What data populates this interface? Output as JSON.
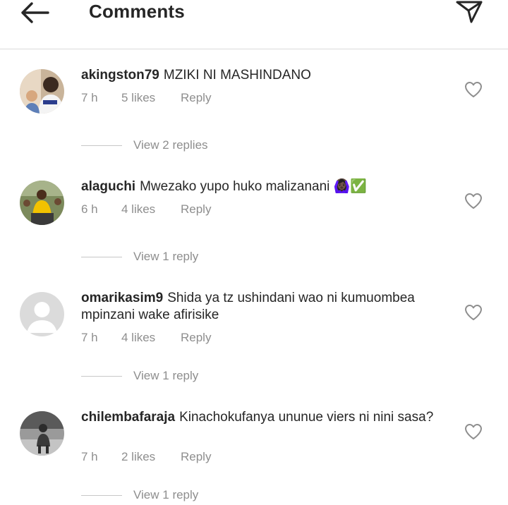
{
  "header": {
    "title": "Comments",
    "back_icon": "arrow-left-icon",
    "share_icon": "paper-plane-icon"
  },
  "comments": [
    {
      "username": "akingston79",
      "text": "MZIKI NI MASHINDANO",
      "time": "7 h",
      "likes": "5 likes",
      "reply": "Reply",
      "view_replies": "View 2 replies",
      "avatar_icon": "user-photo-avatar"
    },
    {
      "username": "alaguchi",
      "text": "Mwezako yupo huko malizanani 🙆🏿‍♀️✅",
      "time": "6 h",
      "likes": "4 likes",
      "reply": "Reply",
      "view_replies": "View 1 reply",
      "avatar_icon": "user-photo-avatar"
    },
    {
      "username": "omarikasim9",
      "text": "Shida ya tz ushindani wao ni kumuombea mpinzani wake afirisike",
      "time": "7 h",
      "likes": "4 likes",
      "reply": "Reply",
      "view_replies": "View 1 reply",
      "avatar_icon": "default-user-avatar"
    },
    {
      "username": "chilembafaraja",
      "text": "Kinachokufanya ununue viers  ni nini sasa?",
      "time": "7 h",
      "likes": "2 likes",
      "reply": "Reply",
      "view_replies": "View 1 reply",
      "avatar_icon": "user-photo-avatar"
    }
  ],
  "colors": {
    "text": "#262626",
    "secondary": "#8e8e8e",
    "divider": "#dbdbdb"
  }
}
